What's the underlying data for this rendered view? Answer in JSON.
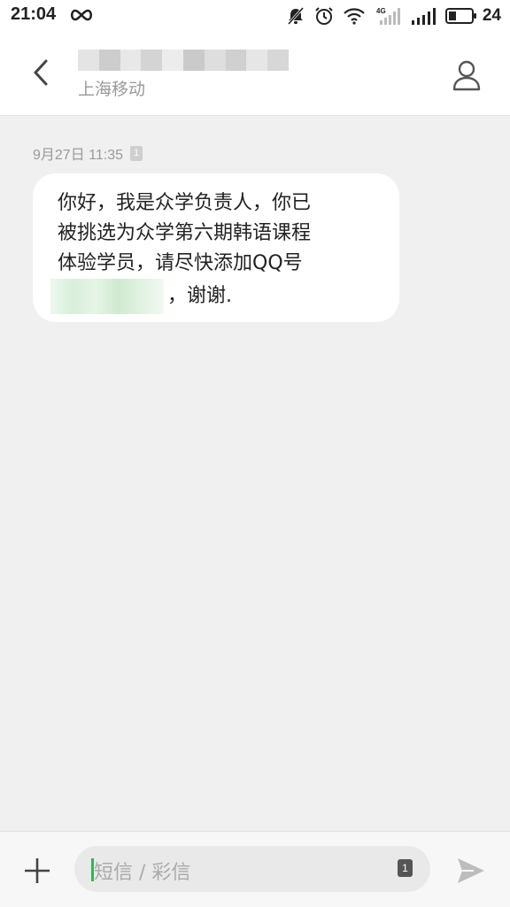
{
  "status_bar": {
    "time": "21:04",
    "battery_level": "24",
    "icons": [
      "infinity-icon",
      "muted-bell-icon",
      "alarm-icon",
      "wifi-icon",
      "signal-4g-icon",
      "signal-icon",
      "battery-icon"
    ]
  },
  "header": {
    "contact_name_redacted": true,
    "carrier": "上海移动",
    "back_icon": "chevron-left-icon",
    "contact_icon": "person-icon"
  },
  "conversation": {
    "messages": [
      {
        "timestamp": "9月27日 11:35",
        "sim": "1",
        "lines": [
          "你好，我是众学负责人，你已",
          "被挑选为众学第六期韩语课程",
          "体验学员，请尽快添加QQ号"
        ],
        "closing": "，谢谢."
      }
    ]
  },
  "input_bar": {
    "placeholder": "短信 / 彩信",
    "sim": "1",
    "add_icon": "plus-icon",
    "send_icon": "send-icon"
  },
  "colors": {
    "accent": "#3bb15a",
    "background": "#f0f0f0",
    "bubble": "#ffffff",
    "muted_text": "#9a9a9a"
  }
}
